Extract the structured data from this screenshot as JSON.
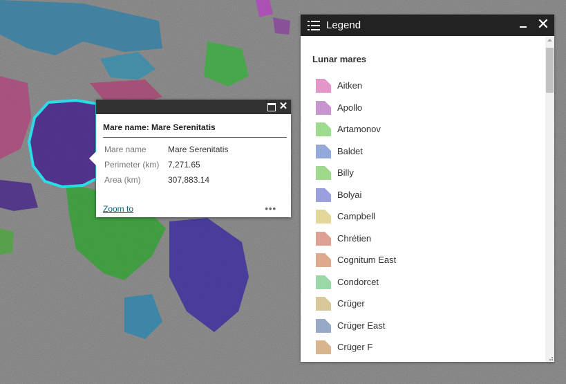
{
  "map": {
    "name": "lunar-surface-map"
  },
  "popup": {
    "title": "Mare name: Mare Serenitatis",
    "fields": [
      {
        "key": "Mare name",
        "value": "Mare Serenitatis"
      },
      {
        "key": "Perimeter (km)",
        "value": "7,271.65"
      },
      {
        "key": "Area (km)",
        "value": "307,883.14"
      }
    ],
    "zoom_label": "Zoom to",
    "more_label": "•••",
    "maximize_icon": "maximize-icon",
    "close_icon": "close-icon"
  },
  "legend": {
    "title": "Legend",
    "layer_title": "Lunar mares",
    "items": [
      {
        "label": "Aitken",
        "color": "#e495c9"
      },
      {
        "label": "Apollo",
        "color": "#c796cf"
      },
      {
        "label": "Artamonov",
        "color": "#9ddc8e"
      },
      {
        "label": "Baldet",
        "color": "#93a9dc"
      },
      {
        "label": "Billy",
        "color": "#9fd98c"
      },
      {
        "label": "Bolyai",
        "color": "#9a9fdd"
      },
      {
        "label": "Campbell",
        "color": "#e4d79a"
      },
      {
        "label": "Chrétien",
        "color": "#dea092"
      },
      {
        "label": "Cognitum East",
        "color": "#dfa98c"
      },
      {
        "label": "Condorcet",
        "color": "#9bd8a8"
      },
      {
        "label": "Crüger",
        "color": "#d9c99a"
      },
      {
        "label": "Crüger East",
        "color": "#98a9c8"
      },
      {
        "label": "Crüger F",
        "color": "#d9b58f"
      }
    ]
  },
  "colors": {
    "popup_bar": "#323232",
    "legend_bar": "#222222",
    "selection": "#22e5f0"
  }
}
